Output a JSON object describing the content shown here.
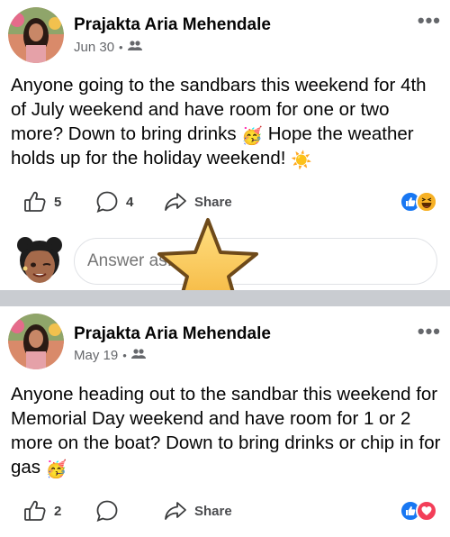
{
  "posts": [
    {
      "author": "Prajakta Aria Mehendale",
      "date": "Jun 30",
      "audience_icon": "friends-icon",
      "text_parts": [
        "Anyone going to the sandbars this weekend for 4th of July weekend and have room for one or two more? Down to bring drinks ",
        " Hope the weather holds up for the holiday weekend! "
      ],
      "emoji_party": "🥳",
      "emoji_sun": "☀️",
      "likes": "5",
      "comments": "4",
      "share_label": "Share",
      "reactions": [
        "like",
        "haha"
      ]
    },
    {
      "author": "Prajakta Aria Mehendale",
      "date": "May 19",
      "audience_icon": "friends-icon",
      "text_parts": [
        "Anyone heading out to the sandbar this weekend for Memorial Day weekend and have room for 1 or 2 more on the boat? Down to bring drinks or chip in for gas "
      ],
      "emoji_party": "🥳",
      "likes": "2",
      "comments": "",
      "share_label": "Share",
      "reactions": [
        "like",
        "love"
      ]
    }
  ],
  "comment_box": {
    "placeholder": "Answer as..."
  },
  "more_label": "•••",
  "meta_separator": "•",
  "colors": {
    "like_blue": "#1877f2",
    "love_red": "#f33e58",
    "haha_yellow": "#f7b125",
    "muted": "#65676b"
  }
}
